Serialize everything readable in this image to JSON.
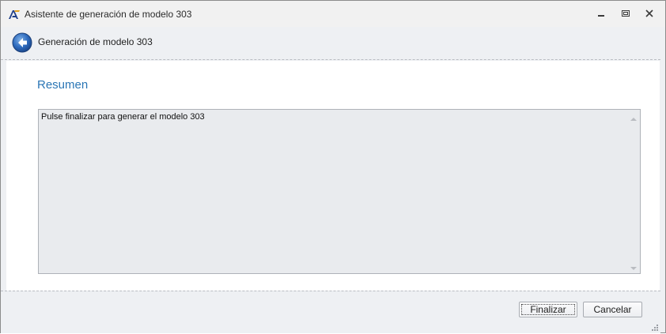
{
  "window": {
    "title": "Asistente de generación de modelo 303",
    "app_icon": "aeat-logo-icon",
    "controls": [
      "minimize-icon",
      "restore-icon",
      "close-icon"
    ]
  },
  "header": {
    "back_icon": "back-arrow-icon",
    "title": "Generación de modelo 303"
  },
  "content": {
    "heading": "Resumen",
    "summary_text": "Pulse finalizar para generar el modelo 303"
  },
  "footer": {
    "finish_label": "Finalizar",
    "cancel_label": "Cancelar"
  },
  "colors": {
    "accent": "#2a76b5",
    "panel_bg": "#eef0f3",
    "textbox_bg": "#e9ebee"
  }
}
